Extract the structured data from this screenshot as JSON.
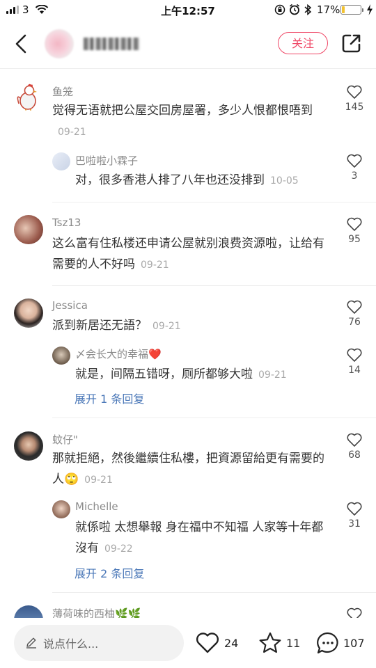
{
  "status_bar": {
    "carrier": "3",
    "time": "上午12:57",
    "battery": "17%",
    "battery_level": 0.17
  },
  "header": {
    "follow_label": "关注"
  },
  "comments": [
    {
      "name": "鱼笼",
      "text": "觉得无语就把公屋交回房屋署，多少人恨都恨唔到",
      "date": "09-21",
      "likes": "145",
      "replies": [
        {
          "name": "巴啦啦小霖子",
          "text": "对，很多香港人排了八年也还没排到",
          "date": "10-05",
          "likes": "3"
        }
      ]
    },
    {
      "name": "Tsz13",
      "text": "这么富有住私楼还申请公屋就别浪费资源啦，让给有需要的人不好吗",
      "date": "09-21",
      "likes": "95",
      "replies": []
    },
    {
      "name": "Jessica",
      "text": "派到新居还无語？",
      "date": "09-21",
      "likes": "76",
      "replies": [
        {
          "name": "〆会长大的幸福❤️",
          "text": "就是，间隔五错呀，厕所都够大啦",
          "date": "09-21",
          "likes": "14"
        }
      ],
      "expand_label": "展开 1 条回复"
    },
    {
      "name": "蚊仔\"",
      "text": "那就拒絕，然後繼續住私樓，把資源留給更有需要的人🙄",
      "date": "09-21",
      "likes": "68",
      "replies": [
        {
          "name": "Michelle",
          "text": "就係啦 太想舉報 身在福中不知福 人家等十年都沒有",
          "date": "09-22",
          "likes": "31"
        }
      ],
      "expand_label": "展开 2 条回复"
    },
    {
      "name": "薄荷味的西柚🌿🌿",
      "text": "",
      "date": "",
      "likes": "",
      "replies": []
    }
  ],
  "bottom_bar": {
    "input_placeholder": "说点什么...",
    "likes": "24",
    "stars": "11",
    "comments": "107"
  },
  "colors": {
    "accent": "#ef4766",
    "link": "#4b78b8"
  }
}
